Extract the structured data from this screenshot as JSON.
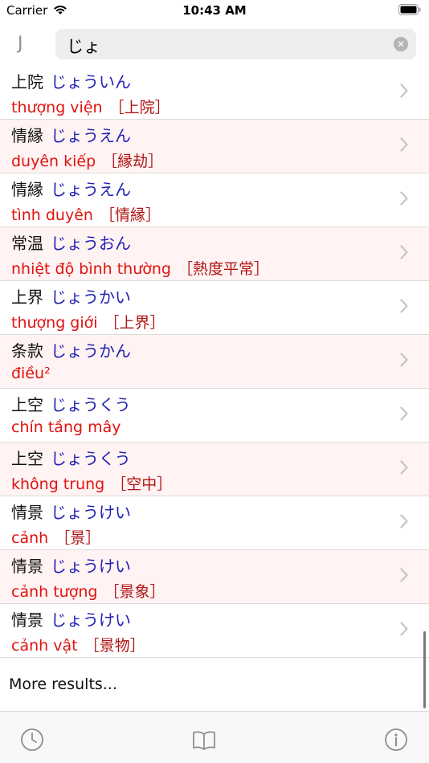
{
  "status_bar": {
    "carrier": "Carrier",
    "time": "10:43 AM"
  },
  "search": {
    "lang_label": "J",
    "query": "じょ",
    "clear_icon": "clear-icon"
  },
  "results": [
    {
      "kanji": "上院",
      "kana": "じょういん",
      "meaning": "thượng viện",
      "bracket": "［上院］"
    },
    {
      "kanji": "情縁",
      "kana": "じょうえん",
      "meaning": "duyên kiếp",
      "bracket": "［縁劫］"
    },
    {
      "kanji": "情縁",
      "kana": "じょうえん",
      "meaning": "tình duyên",
      "bracket": "［情縁］"
    },
    {
      "kanji": "常温",
      "kana": "じょうおん",
      "meaning": "nhiệt độ bình thường",
      "bracket": "［熱度平常］"
    },
    {
      "kanji": "上界",
      "kana": "じょうかい",
      "meaning": "thượng giới",
      "bracket": "［上界］"
    },
    {
      "kanji": "条款",
      "kana": "じょうかん",
      "meaning": "điều²",
      "bracket": ""
    },
    {
      "kanji": "上空",
      "kana": "じょうくう",
      "meaning": "chín tầng mây",
      "bracket": ""
    },
    {
      "kanji": "上空",
      "kana": "じょうくう",
      "meaning": "không trung",
      "bracket": "［空中］"
    },
    {
      "kanji": "情景",
      "kana": "じょうけい",
      "meaning": "cảnh",
      "bracket": "［景］"
    },
    {
      "kanji": "情景",
      "kana": "じょうけい",
      "meaning": "cảnh tượng",
      "bracket": "［景象］"
    },
    {
      "kanji": "情景",
      "kana": "じょうけい",
      "meaning": "cảnh vật",
      "bracket": "［景物］"
    }
  ],
  "more_results": "More results...",
  "tabs": [
    {
      "icon": "clock-icon"
    },
    {
      "icon": "book-icon"
    },
    {
      "icon": "info-icon"
    }
  ],
  "colors": {
    "kana": "#2121b5",
    "meaning": "#e0120f",
    "alt_row": "#fff3f3",
    "tab_icon": "#8e8e93"
  }
}
